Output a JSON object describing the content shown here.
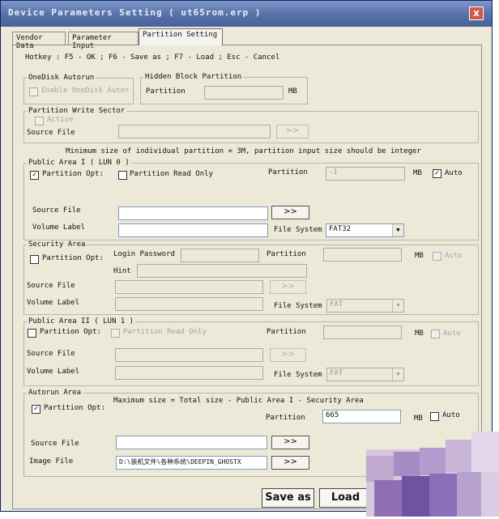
{
  "window": {
    "title": "Device Parameters Setting ( ut65rom.erp )",
    "close_label": "x"
  },
  "tabs": [
    {
      "label": "Vendor Data"
    },
    {
      "label": "Parameter Input"
    },
    {
      "label": "Partition Setting"
    }
  ],
  "hotkey": "Hotkey : F5 - OK ; F6 - Save as ; F7 - Load ; Esc - Cancel",
  "onedisk": {
    "title": "OneDisk Autorun",
    "checkbox": "Enable OneDisk Autor"
  },
  "hidden_block": {
    "title": "Hidden Block Partition",
    "partition_label": "Partition",
    "unit": "MB"
  },
  "write_sector": {
    "title": "Partition Write Sector",
    "active": "Active",
    "source_label": "Source File",
    "browse": ">>"
  },
  "min_size_note": "Minimum size of individual partition = 3M, partition input size should be integer",
  "public1": {
    "title": "Public Area I ( LUN 0 )",
    "opt": "Partition Opt:",
    "read_only": "Partition Read Only",
    "partition_label": "Partition",
    "partition_value": "-1",
    "unit": "MB",
    "auto": "Auto",
    "source_label": "Source File",
    "browse": ">>",
    "volume_label": "Volume Label",
    "fs_label": "File System",
    "fs_value": "FAT32"
  },
  "security": {
    "title": "Security Area",
    "opt": "Partition Opt:",
    "login_label": "Login Password",
    "hint_label": "Hint",
    "partition_label": "Partition",
    "unit": "MB",
    "auto": "Auto",
    "source_label": "Source File",
    "browse": ">>",
    "volume_label": "Volume Label",
    "fs_label": "File System",
    "fs_value": "FAT"
  },
  "public2": {
    "title": "Public Area II ( LUN 1 )",
    "opt": "Partition Opt:",
    "read_only": "Partition Read Only",
    "partition_label": "Partition",
    "unit": "MB",
    "auto": "Auto",
    "source_label": "Source File",
    "browse": ">>",
    "volume_label": "Volume Label",
    "fs_label": "File System",
    "fs_value": "FAT"
  },
  "autorun": {
    "title": "Autorun Area",
    "opt": "Partition Opt:",
    "max_note": "Maximum size = Total size - Public Area I - Security Area",
    "partition_label": "Partition",
    "partition_value": "665",
    "unit": "MB",
    "auto": "Auto",
    "source_label": "Source File",
    "browse": ">>",
    "image_label": "Image File",
    "image_value": "D:\\装机文件\\各种系统\\DEEPIN_GHOSTX",
    "browse2": ">>"
  },
  "footer": {
    "save_as": "Save as",
    "load": "Load"
  }
}
